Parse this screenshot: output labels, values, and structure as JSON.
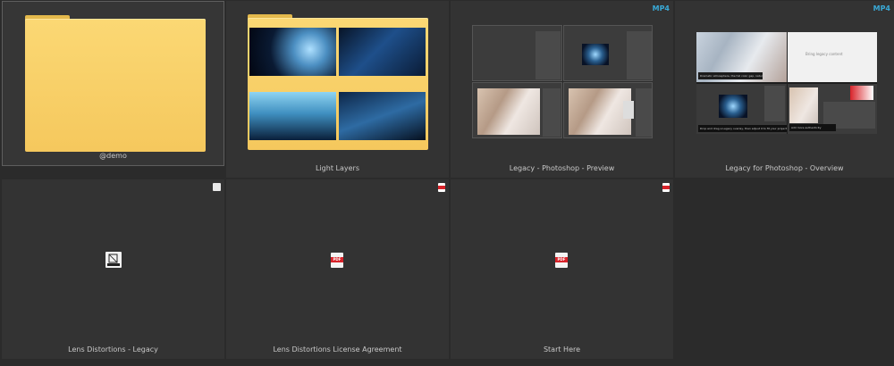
{
  "tiles": [
    {
      "label": "@demo"
    },
    {
      "label": "Light Layers"
    },
    {
      "label": "Legacy - Photoshop - Preview",
      "badge": "MP4"
    },
    {
      "label": "Legacy for Photoshop - Overview",
      "badge": "MP4"
    },
    {
      "label": "Lens Distortions - Legacy"
    },
    {
      "label": "Lens Distortions License Agreement"
    },
    {
      "label": "Start Here"
    }
  ],
  "icons": {
    "folder": "folder-icon",
    "pdf": "pdf-icon",
    "app": "app-icon",
    "video": "video-thumbnail"
  },
  "overview": {
    "caption_left": "Dramatic atmosphere, the full color gap, natural effects",
    "caption_right": "Add more authenticity",
    "caption_top": "Bring legacy content",
    "caption_bottom": "Drop and drag a Legacy overlay, then adjust it to fit your project"
  },
  "pdf_label": "PDF",
  "colors": {
    "background": "#2b2b2b",
    "tile": "#333333",
    "badge": "#39a9d6",
    "folder": "#f5c85d",
    "pdf_red": "#d8232a"
  }
}
